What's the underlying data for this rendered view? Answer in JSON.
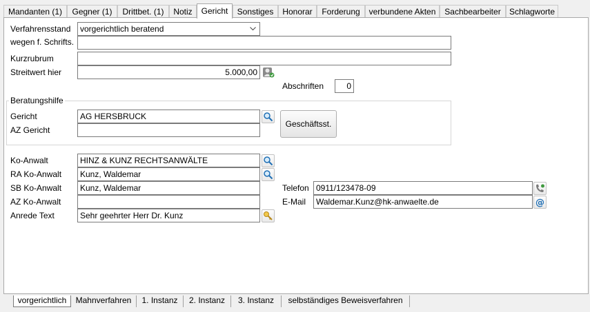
{
  "top_tabs": [
    "Mandanten (1)",
    "Gegner (1)",
    "Drittbet. (1)",
    "Notiz",
    "Gericht",
    "Sonstiges",
    "Honorar",
    "Forderung",
    "verbundene Akten",
    "Sachbearbeiter",
    "Schlagworte"
  ],
  "active_top_tab": "Gericht",
  "form": {
    "verfahrensstand_label": "Verfahrensstand",
    "verfahrensstand_value": "vorgerichtlich beratend",
    "schrifts_label": "wegen f. Schrifts.",
    "schrifts_value": "",
    "kurzrubrum_label": "Kurzrubrum",
    "kurzrubrum_value": "",
    "streitwert_label": "Streitwert hier",
    "streitwert_value": "5.000,00",
    "abschriften_label": "Abschriften",
    "abschriften_value": "0"
  },
  "beratungshilfe": {
    "title": "Beratungshilfe",
    "gericht_label": "Gericht",
    "gericht_value": "AG HERSBRUCK",
    "az_label": "AZ Gericht",
    "az_value": "",
    "geschaeftsst_button": "Geschäftsst."
  },
  "anwalt": {
    "ko_label": "Ko-Anwalt",
    "ko_value": "HINZ & KUNZ RECHTSANWÄLTE",
    "ra_label": "RA Ko-Anwalt",
    "ra_value": "Kunz, Waldemar",
    "sb_label": "SB Ko-Anwalt",
    "sb_value": "Kunz, Waldemar",
    "az_label": "AZ Ko-Anwalt",
    "az_value": "",
    "anrede_label": "Anrede Text",
    "anrede_value": "Sehr geehrter Herr Dr. Kunz",
    "telefon_label": "Telefon",
    "telefon_value": "0911/123478-09",
    "email_label": "E-Mail",
    "email_value": "Waldemar.Kunz@hk-anwaelte.de"
  },
  "bottom_tabs": [
    "vorgerichtlich",
    "Mahnverfahren",
    "1. Instanz",
    "2. Instanz",
    "3. Instanz",
    "selbständiges Beweisverfahren"
  ],
  "active_bottom_tab": "vorgerichtlich",
  "icons": [
    "search-icon",
    "calculator-person-icon",
    "key-icon",
    "phone-icon",
    "email-at-icon",
    "chevron-down-icon"
  ],
  "colors": {
    "panel_bg": "#ffffff",
    "window_bg": "#f0f0f0",
    "icon_blue": "#1f6fb5"
  }
}
